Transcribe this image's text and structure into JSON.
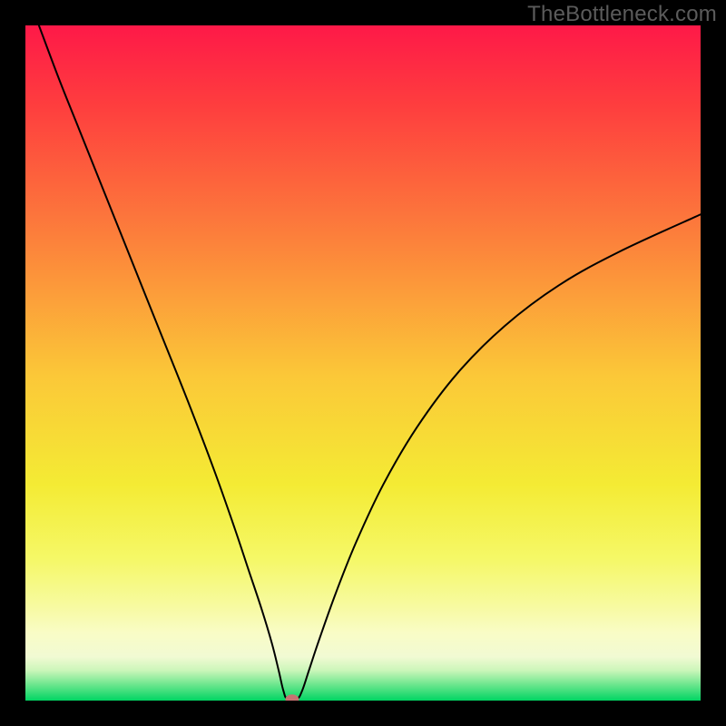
{
  "watermark": "TheBottleneck.com",
  "chart_data": {
    "type": "line",
    "title": "",
    "xlabel": "",
    "ylabel": "",
    "xlim": [
      0,
      100
    ],
    "ylim": [
      0,
      100
    ],
    "grid": false,
    "legend": false,
    "background_gradient": {
      "stops": [
        {
          "pos": 0.0,
          "color": "#FE1948"
        },
        {
          "pos": 0.12,
          "color": "#FE3E3E"
        },
        {
          "pos": 0.32,
          "color": "#FC823B"
        },
        {
          "pos": 0.52,
          "color": "#FBC838"
        },
        {
          "pos": 0.68,
          "color": "#F4EB34"
        },
        {
          "pos": 0.79,
          "color": "#F5F867"
        },
        {
          "pos": 0.86,
          "color": "#F7FAA0"
        },
        {
          "pos": 0.9,
          "color": "#F9FCC6"
        },
        {
          "pos": 0.935,
          "color": "#F1FAD3"
        },
        {
          "pos": 0.955,
          "color": "#CCF6BA"
        },
        {
          "pos": 0.975,
          "color": "#72E790"
        },
        {
          "pos": 1.0,
          "color": "#01D563"
        }
      ]
    },
    "series": [
      {
        "name": "curve",
        "x": [
          2,
          5,
          8,
          12,
          16,
          20,
          24,
          28,
          31,
          33,
          35,
          36.5,
          37.5,
          38.2,
          38.8,
          40.2,
          41,
          42,
          43.5,
          46,
          49,
          53,
          58,
          64,
          71,
          79,
          88,
          100
        ],
        "y": [
          100,
          92,
          84.5,
          74.5,
          64.5,
          54.5,
          44.5,
          34,
          25.5,
          19.5,
          13.5,
          8.5,
          4.5,
          1.5,
          0.2,
          0.2,
          1.5,
          4.5,
          9,
          16,
          23.5,
          32,
          40.5,
          48.5,
          55.5,
          61.5,
          66.5,
          72
        ]
      }
    ],
    "marker": {
      "x": 39.5,
      "y": 0.2,
      "color": "#C77272"
    }
  }
}
